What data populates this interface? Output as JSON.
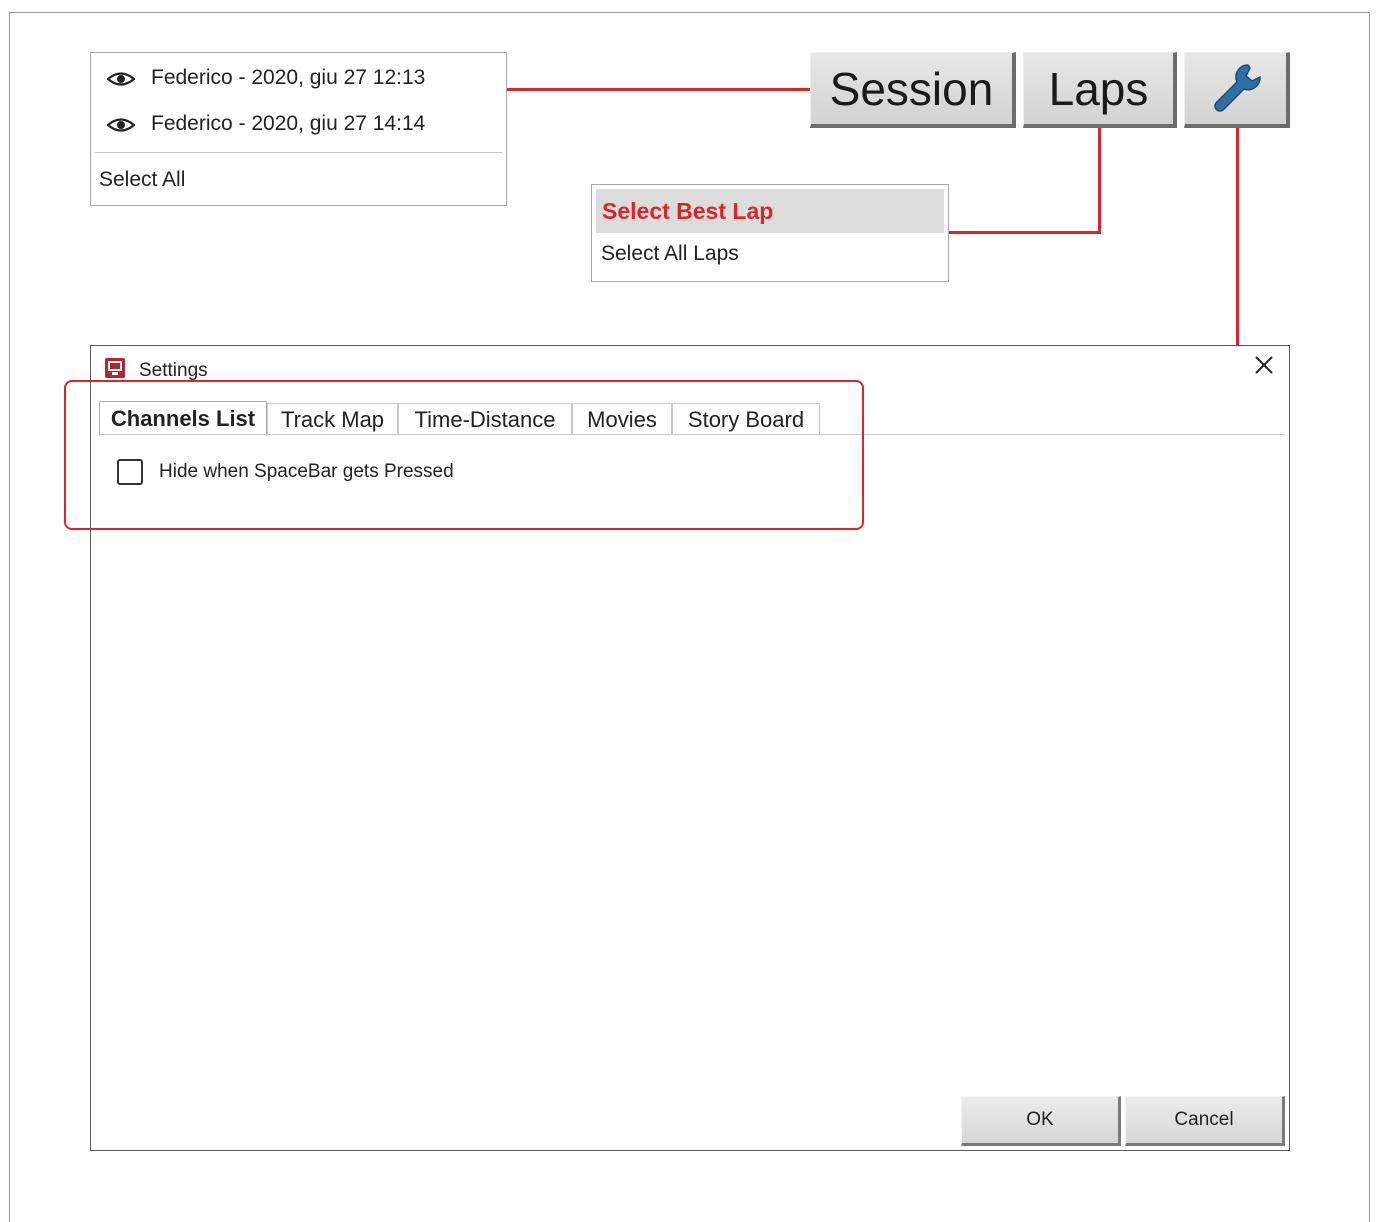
{
  "session_menu": {
    "items": [
      {
        "label": "Federico - 2020, giu 27 12:13",
        "icon": "eye-icon"
      },
      {
        "label": "Federico - 2020, giu 27 14:14",
        "icon": "eye-icon"
      }
    ],
    "select_all": "Select All"
  },
  "toolbar": {
    "session_label": "Session",
    "laps_label": "Laps",
    "settings_icon": "wrench-icon"
  },
  "laps_menu": {
    "best": "Select Best Lap",
    "all": "Select All Laps"
  },
  "settings_dialog": {
    "title": "Settings",
    "tabs": [
      {
        "label": "Channels List",
        "active": true
      },
      {
        "label": "Track Map"
      },
      {
        "label": "Time-Distance"
      },
      {
        "label": "Movies"
      },
      {
        "label": "Story Board"
      }
    ],
    "checkbox": {
      "label": "Hide when SpaceBar gets Pressed",
      "checked": false
    },
    "ok_label": "OK",
    "cancel_label": "Cancel"
  },
  "colors": {
    "accent": "#d8262c",
    "wrench": "#2f6fa8"
  }
}
